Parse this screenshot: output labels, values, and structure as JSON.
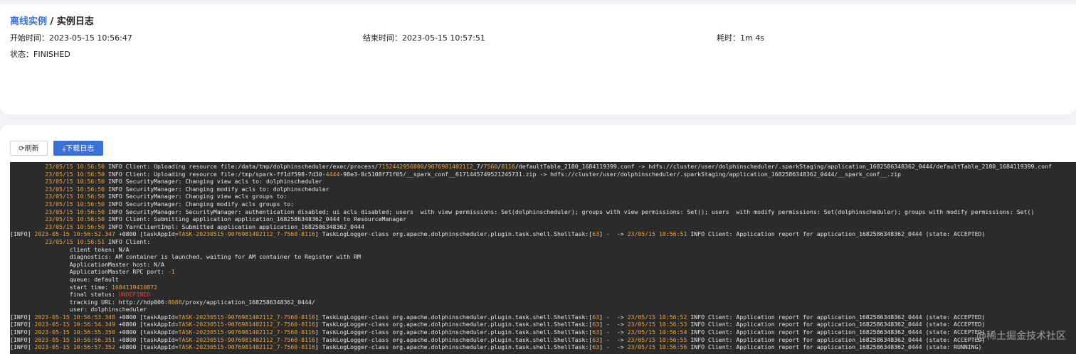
{
  "breadcrumb": {
    "parent": "离线实例",
    "separator": " / ",
    "current": "实例日志"
  },
  "meta": {
    "start_label": "开始时间：",
    "start_value": "2023-05-15 10:56:47",
    "end_label": "结束时间：",
    "end_value": "2023-05-15 10:57:51",
    "duration_label": "耗时：",
    "duration_value": "1m 4s",
    "status_label": "状态：",
    "status_value": "FINISHED"
  },
  "toolbar": {
    "refresh_label": "⟳刷新",
    "download_label": "⤓下载日志"
  },
  "log": {
    "lines": [
      [
        [
          "w",
          "          "
        ],
        [
          "o",
          "23/05/15 10:56:50"
        ],
        [
          "w",
          " INFO Client: Uploading resource file:/data/tmp/dolphinscheduler/exec/process/"
        ],
        [
          "o",
          "7152442956800"
        ],
        [
          "w",
          "/"
        ],
        [
          "o",
          "9076981402112"
        ],
        [
          "w",
          "_7/"
        ],
        [
          "o",
          "7560"
        ],
        [
          "w",
          "/"
        ],
        [
          "o",
          "8116"
        ],
        [
          "w",
          "/defaultTable_2180_1684119399.conf -> hdfs://cluster/user/dolphinscheduler/.sparkStaging/application_1682586348362_0444/defaultTable_2180_1684119399.conf"
        ]
      ],
      [
        [
          "w",
          "          "
        ],
        [
          "o",
          "23/05/15 10:56:50"
        ],
        [
          "w",
          " INFO Client: Uploading resource file:/tmp/spark-ff1df598-7d30-"
        ],
        [
          "o",
          "4444"
        ],
        [
          "w",
          "-98e3-8c5108f71f05/__spark_conf__6171445749521245731.zip -> hdfs://cluster/user/dolphinscheduler/.sparkStaging/application_1682586348362_0444/__spark_conf__.zip"
        ]
      ],
      [
        [
          "w",
          "          "
        ],
        [
          "o",
          "23/05/15 10:56:50"
        ],
        [
          "w",
          " INFO SecurityManager: Changing view acls to: dolphinscheduler"
        ]
      ],
      [
        [
          "w",
          "          "
        ],
        [
          "o",
          "23/05/15 10:56:50"
        ],
        [
          "w",
          " INFO SecurityManager: Changing modify acls to: dolphinscheduler"
        ]
      ],
      [
        [
          "w",
          "          "
        ],
        [
          "o",
          "23/05/15 10:56:50"
        ],
        [
          "w",
          " INFO SecurityManager: Changing view acls groups to:"
        ]
      ],
      [
        [
          "w",
          "          "
        ],
        [
          "o",
          "23/05/15 10:56:50"
        ],
        [
          "w",
          " INFO SecurityManager: Changing modify acls groups to:"
        ]
      ],
      [
        [
          "w",
          "          "
        ],
        [
          "o",
          "23/05/15 10:56:50"
        ],
        [
          "w",
          " INFO SecurityManager: SecurityManager: authentication disabled; ui acls disabled; users  with view permissions: Set(dolphinscheduler); groups with view permissions: Set(); users  with modify permissions: Set(dolphinscheduler); groups with modify permissions: Set()"
        ]
      ],
      [
        [
          "w",
          "          "
        ],
        [
          "o",
          "23/05/15 10:56:50"
        ],
        [
          "w",
          " INFO Client: Submitting application application_1682586348362_0444 to ResourceManager"
        ]
      ],
      [
        [
          "w",
          "          "
        ],
        [
          "o",
          "23/05/15 10:56:50"
        ],
        [
          "w",
          " INFO YarnClientImpl: Submitted application application_1682586348362_0444"
        ]
      ],
      [
        [
          "w",
          "[INFO] "
        ],
        [
          "o",
          "2023-05-15 10:56:52.347"
        ],
        [
          "w",
          " +0800 [taskAppId="
        ],
        [
          "o",
          "TASK-20230515-9076981402112_7-7560-8116"
        ],
        [
          "w",
          "] TaskLogLogger-class org.apache.dolphinscheduler.plugin.task.shell.ShellTask:["
        ],
        [
          "o",
          "63"
        ],
        [
          "w",
          "] -  -> "
        ],
        [
          "o",
          "23/05/15 10:56:51"
        ],
        [
          "w",
          " INFO Client: Application report for application_1682586348362_0444 (state: ACCEPTED)"
        ]
      ],
      [
        [
          "w",
          "          "
        ],
        [
          "o",
          "23/05/15 10:56:51"
        ],
        [
          "w",
          " INFO Client:"
        ]
      ],
      [
        [
          "w",
          "                 client token: N/A"
        ]
      ],
      [
        [
          "w",
          "                 diagnostics: AM container is launched, waiting for AM container to Register with RM"
        ]
      ],
      [
        [
          "w",
          "                 ApplicationMaster host: N/A"
        ]
      ],
      [
        [
          "w",
          "                 ApplicationMaster RPC port: "
        ],
        [
          "o",
          "-1"
        ]
      ],
      [
        [
          "w",
          "                 queue: default"
        ]
      ],
      [
        [
          "w",
          "                 start time: "
        ],
        [
          "o",
          "1684119410872"
        ]
      ],
      [
        [
          "w",
          "                 final status: "
        ],
        [
          "r",
          "UNDEFINED"
        ]
      ],
      [
        [
          "w",
          "                 tracking URL: http://hdp006:"
        ],
        [
          "o",
          "8088"
        ],
        [
          "w",
          "/proxy/application_1682586348362_0444/"
        ]
      ],
      [
        [
          "w",
          "                 user: dolphinscheduler"
        ]
      ],
      [
        [
          "w",
          "[INFO] "
        ],
        [
          "o",
          "2023-05-15 10:56:53.348"
        ],
        [
          "w",
          " +0800 [taskAppId="
        ],
        [
          "o",
          "TASK-20230515-9076981402112_7-7560-8116"
        ],
        [
          "w",
          "] TaskLogLogger-class org.apache.dolphinscheduler.plugin.task.shell.ShellTask:["
        ],
        [
          "o",
          "63"
        ],
        [
          "w",
          "] -  -> "
        ],
        [
          "o",
          "23/05/15 10:56:52"
        ],
        [
          "w",
          " INFO Client: Application report for application_1682586348362_0444 (state: ACCEPTED)"
        ]
      ],
      [
        [
          "w",
          "[INFO] "
        ],
        [
          "o",
          "2023-05-15 10:56:54.349"
        ],
        [
          "w",
          " +0800 [taskAppId="
        ],
        [
          "o",
          "TASK-20230515-9076981402112_7-7560-8116"
        ],
        [
          "w",
          "] TaskLogLogger-class org.apache.dolphinscheduler.plugin.task.shell.ShellTask:["
        ],
        [
          "o",
          "63"
        ],
        [
          "w",
          "] -  -> "
        ],
        [
          "o",
          "23/05/15 10:56:53"
        ],
        [
          "w",
          " INFO Client: Application report for application_1682586348362_0444 (state: ACCEPTED)"
        ]
      ],
      [
        [
          "w",
          "[INFO] "
        ],
        [
          "o",
          "2023-05-15 10:56:55.350"
        ],
        [
          "w",
          " +0800 [taskAppId="
        ],
        [
          "o",
          "TASK-20230515-9076981402112_7-7560-8116"
        ],
        [
          "w",
          "] TaskLogLogger-class org.apache.dolphinscheduler.plugin.task.shell.ShellTask:["
        ],
        [
          "o",
          "63"
        ],
        [
          "w",
          "] -  -> "
        ],
        [
          "o",
          "23/05/15 10:56:54"
        ],
        [
          "w",
          " INFO Client: Application report for application_1682586348362_0444 (state: ACCEPTED)"
        ]
      ],
      [
        [
          "w",
          "[INFO] "
        ],
        [
          "o",
          "2023-05-15 10:56:56.351"
        ],
        [
          "w",
          " +0800 [taskAppId="
        ],
        [
          "o",
          "TASK-20230515-9076981402112_7-7560-8116"
        ],
        [
          "w",
          "] TaskLogLogger-class org.apache.dolphinscheduler.plugin.task.shell.ShellTask:["
        ],
        [
          "o",
          "63"
        ],
        [
          "w",
          "] -  -> "
        ],
        [
          "o",
          "23/05/15 10:56:55"
        ],
        [
          "w",
          " INFO Client: Application report for application_1682586348362_0444 (state: ACCEPTED)"
        ]
      ],
      [
        [
          "w",
          "[INFO] "
        ],
        [
          "o",
          "2023-05-15 10:56:57.352"
        ],
        [
          "w",
          " +0800 [taskAppId="
        ],
        [
          "o",
          "TASK-20230515-9076981402112_7-7560-8116"
        ],
        [
          "w",
          "] TaskLogLogger-class org.apache.dolphinscheduler.plugin.task.shell.ShellTask:["
        ],
        [
          "o",
          "63"
        ],
        [
          "w",
          "] -  -> "
        ],
        [
          "o",
          "23/05/15 10:56:56"
        ],
        [
          "w",
          " INFO Client: Application report for application_1682586348362_0444 (state: RUNNING)"
        ]
      ]
    ]
  },
  "watermark": "@稀土掘金技术社区",
  "colors": {
    "accent": "#3b6fd8",
    "console_bg": "#2b2b2b",
    "log_orange": "#e8a33d",
    "log_red": "#e0443e"
  }
}
